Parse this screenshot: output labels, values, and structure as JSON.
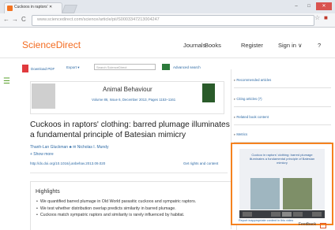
{
  "browser": {
    "tab_title": "Cuckoos in raptors' ✕",
    "tab_close": "×",
    "url_host": "www.sciencedirect.com",
    "url_path": "/science/article/pii/S0003347213004247",
    "window_controls": [
      "–",
      "□",
      "✕"
    ]
  },
  "header": {
    "logo": "ScienceDirect",
    "nav": [
      "Journals",
      "Books",
      "Register",
      "Sign in ∨"
    ],
    "help": "?"
  },
  "toolbar": {
    "download_pdf": "Download PDF",
    "export": "Export ▾",
    "search_placeholder": "Search ScienceDirect",
    "advanced": "Advanced search"
  },
  "journal": {
    "name": "Animal Behaviour",
    "volume": "Volume 86, Issue 6, December 2013, Pages 1153–1161",
    "publisher": "ELSEVIER"
  },
  "article": {
    "title": "Cuckoos in raptors' clothing: barred plumage illuminates a fundamental principle of Batesian mimicry",
    "authors": "Thanh-Lan Gluckman ♣ ✉   Nicholas I. Mundy",
    "show_more": "+ Show more",
    "doi": "http://dx.doi.org/10.1016/j.anbehav.2013.09.020",
    "rights": "Get rights and content"
  },
  "highlights": {
    "title": "Highlights",
    "items": [
      "We quantified barred plumage in Old World parasitic cuckoos and sympatric raptors.",
      "We test whether distribution overlap predicts similarity in barred plumage.",
      "Cuckoos match sympatric raptors and similarity is rarely influenced by habitat."
    ]
  },
  "right_panel": {
    "items": [
      "Recommended articles",
      "Citing articles (7)",
      "Related book content",
      "Metrics"
    ],
    "video_title": "Cuckoo in raptors' clothing: barred plumage illuminates a fundamental principle of Batesian mimicry",
    "video_report": "Report inappropriate content in this video"
  },
  "footer": {
    "feedback": "Feedback"
  },
  "colors": {
    "brand": "#f36c21",
    "link": "#2e6aa5",
    "highlight_border": "#f5821f"
  }
}
